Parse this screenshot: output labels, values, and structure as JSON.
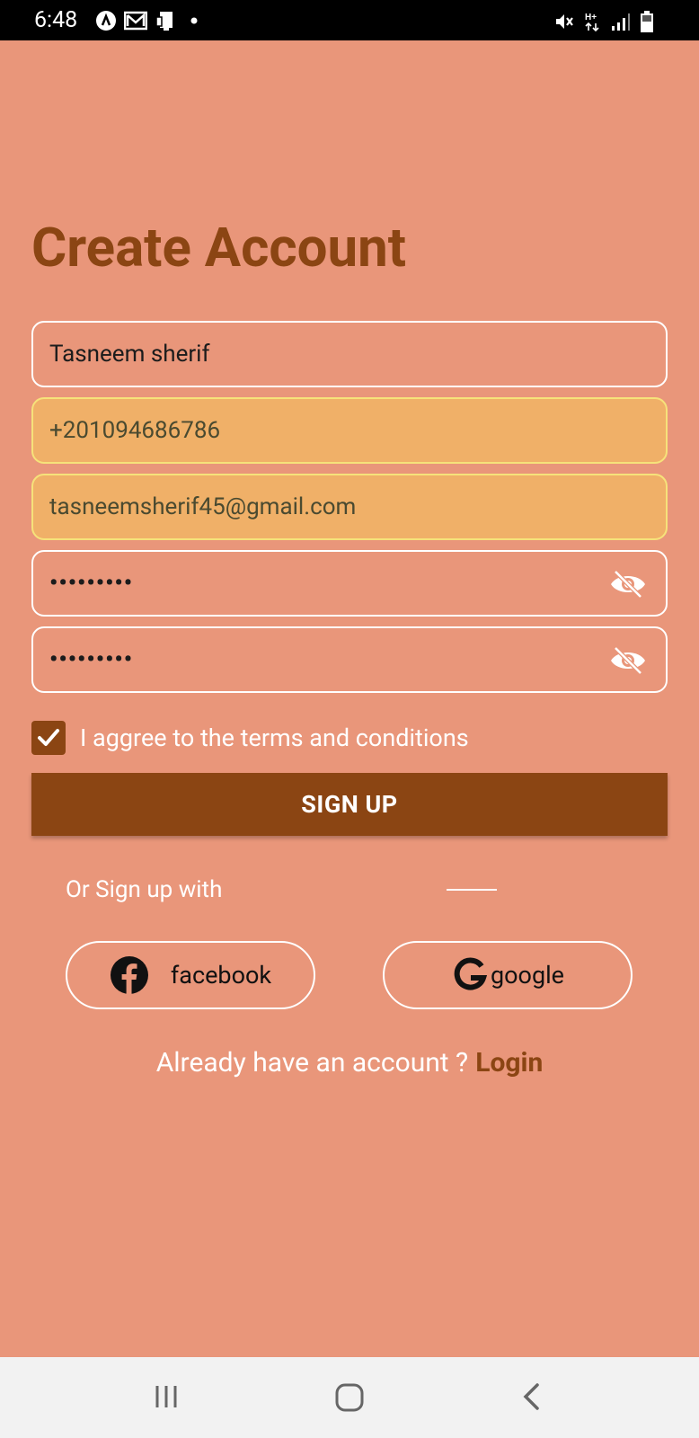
{
  "status_bar": {
    "time": "6:48",
    "left_icons": [
      "app-icon",
      "gmail-icon",
      "device-icon",
      "dot-icon"
    ],
    "right_icons": [
      "mute-icon",
      "network-icon",
      "signal-icon",
      "battery-icon"
    ]
  },
  "page": {
    "title": "Create Account",
    "background_color": "#e9967a",
    "accent_color": "#8b4513"
  },
  "form": {
    "name_value": "Tasneem sherif",
    "phone_value": "+201094686786",
    "email_value": "tasneemsherif45@gmail.com",
    "password_value": "•••••••••",
    "confirm_password_value": "•••••••••",
    "terms_label": "I aggree to the terms and conditions",
    "terms_checked": true,
    "signup_label": "SIGN UP"
  },
  "social": {
    "or_text": "Or Sign up with",
    "facebook_label": "facebook",
    "google_label": "google"
  },
  "footer": {
    "already_text": "Already have an account ?",
    "login_label": "Login"
  },
  "nav_bar": {
    "items": [
      "recents-icon",
      "home-icon",
      "back-icon"
    ]
  }
}
